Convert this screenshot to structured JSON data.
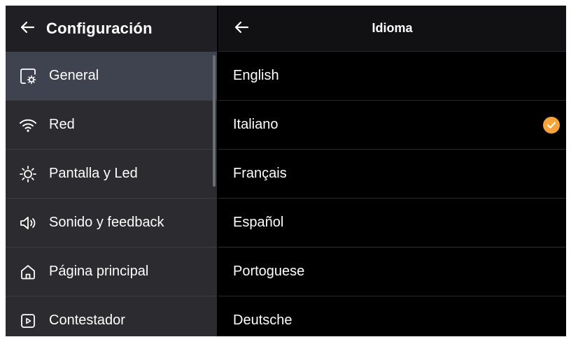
{
  "left_panel": {
    "title": "Configuración",
    "items": [
      {
        "label": "General",
        "icon": "settings-screen-icon",
        "active": true
      },
      {
        "label": "Red",
        "icon": "wifi-icon"
      },
      {
        "label": "Pantalla y Led",
        "icon": "brightness-icon"
      },
      {
        "label": "Sonido y feedback",
        "icon": "speaker-icon"
      },
      {
        "label": "Página principal",
        "icon": "home-icon"
      },
      {
        "label": "Contestador",
        "icon": "play-box-icon"
      }
    ]
  },
  "right_panel": {
    "title": "Idioma",
    "languages": [
      {
        "label": "English"
      },
      {
        "label": "Italiano",
        "selected": true
      },
      {
        "label": "Français"
      },
      {
        "label": "Español"
      },
      {
        "label": "Portoguese"
      },
      {
        "label": "Deutsche"
      }
    ]
  },
  "colors": {
    "accent": "#f5a33b",
    "left_bg": "#2b2b30",
    "active_bg": "#3f434f",
    "right_bg": "#000000"
  }
}
